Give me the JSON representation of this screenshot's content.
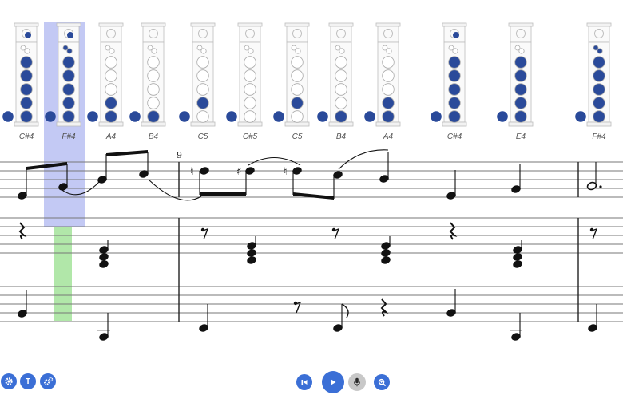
{
  "app": {
    "measure_number": "9",
    "accent_color": "#3b6fd6",
    "highlight_blue": "#b9c0f2",
    "highlight_green": "#a8e4a0",
    "key_filled_color": "#2a4a9a"
  },
  "fingering_charts": [
    {
      "note": "C#4"
    },
    {
      "note": "F#4"
    },
    {
      "note": "A4"
    },
    {
      "note": "B4"
    },
    {
      "note": "C5"
    },
    {
      "note": "C#5"
    },
    {
      "note": "C5"
    },
    {
      "note": "B4"
    },
    {
      "note": "A4"
    },
    {
      "note": "C#4"
    },
    {
      "note": "E4"
    },
    {
      "note": "F#4"
    }
  ],
  "controls": {
    "left": [
      {
        "name": "settings-button",
        "icon": "gear-icon"
      },
      {
        "name": "text-button",
        "icon": "text-icon",
        "label": "T"
      },
      {
        "name": "tools-button",
        "icon": "cogs-icon"
      }
    ],
    "center": [
      {
        "name": "rewind-button",
        "icon": "skip-back-icon"
      },
      {
        "name": "play-button",
        "icon": "play-icon"
      },
      {
        "name": "mic-button",
        "icon": "mic-icon"
      },
      {
        "name": "zoom-button",
        "icon": "zoom-icon"
      }
    ]
  }
}
